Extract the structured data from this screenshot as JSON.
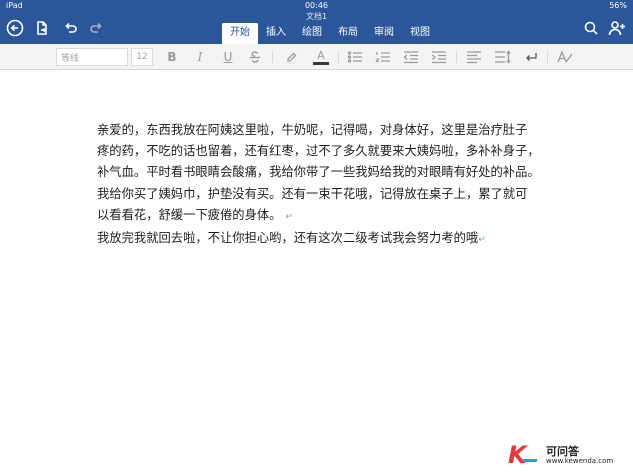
{
  "status": {
    "left": "iPad",
    "time": "00:46",
    "battery": "56%"
  },
  "document": {
    "title": "文档1"
  },
  "tabs": [
    {
      "label": "开始",
      "active": true
    },
    {
      "label": "插入",
      "active": false
    },
    {
      "label": "绘图",
      "active": false
    },
    {
      "label": "布局",
      "active": false
    },
    {
      "label": "审阅",
      "active": false
    },
    {
      "label": "视图",
      "active": false
    }
  ],
  "ribbon": {
    "font_name": "等线",
    "font_size": "12",
    "bold": "B",
    "italic": "I",
    "underline": "U",
    "font_color": "A"
  },
  "body": {
    "lines": [
      "亲爱的，东西我放在阿姨这里啦，牛奶呢，记得喝，对身体好，这里是治疗肚子",
      "疼的药，不吃的话也留着，还有红枣，过不了多久就要来大姨妈啦，多补补身子，",
      "补气血。平时看书眼睛会酸痛，我给你带了一些我妈给我的对眼睛有好处的补品。",
      "我给你买了姨妈巾，护垫没有买。还有一束干花哦，记得放在桌子上，累了就可",
      "以看看花，舒缓一下疲倦的身体。"
    ],
    "last_line": "我放完我就回去啦，不让你担心哟，还有这次二级考试我会努力考的哦",
    "paragraph_mark": "↵"
  },
  "watermark": {
    "logo": "K",
    "name": "可问答",
    "url": "www.kewenda.com"
  },
  "colors": {
    "app_bar": "#2b579a",
    "ribbon": "#f4f4f4",
    "paragraph_mark": "#7aa0d6"
  },
  "icons": {
    "topbar": [
      "back-circle-icon",
      "file-icon",
      "undo-icon",
      "redo-icon",
      "search-icon",
      "add-person-icon"
    ],
    "ribbon": [
      "highlighter-icon",
      "font-color-icon",
      "bullets-icon",
      "numbering-icon",
      "decrease-indent-icon",
      "increase-indent-icon",
      "align-icon",
      "line-spacing-icon",
      "paragraph-mark-icon",
      "styles-icon"
    ]
  }
}
